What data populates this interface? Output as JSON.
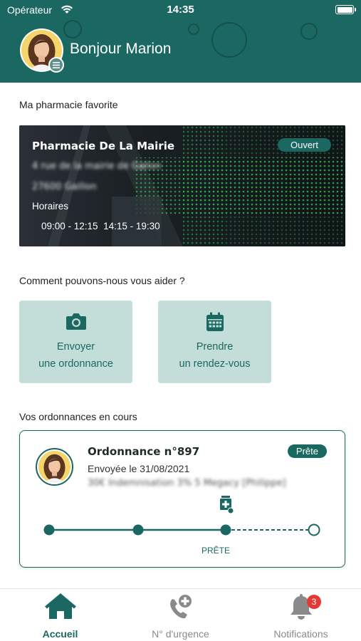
{
  "status_bar": {
    "carrier": "Opérateur",
    "time": "14:35"
  },
  "header": {
    "greeting": "Bonjour Marion",
    "avatar_icon": "user-avatar",
    "menu_icon": "menu-icon",
    "color": "#1b6862"
  },
  "favorite_pharmacy": {
    "section_title": "Ma pharmacie favorite",
    "name": "Pharmacie De La Mairie",
    "address_line1": "4 rue de la mairie de Gallon",
    "address_line2": "27600 Gaillon",
    "hours_label": "Horaires",
    "hours": "09:00 - 12:15  14:15 - 19:30",
    "status_badge": "Ouvert"
  },
  "help": {
    "section_title": "Comment pouvons-nous vous aider ?",
    "actions": [
      {
        "icon": "camera-icon",
        "line1": "Envoyer",
        "line2": "une ordonnance"
      },
      {
        "icon": "calendar-icon",
        "line1": "Prendre",
        "line2": "un rendez-vous"
      }
    ]
  },
  "prescriptions": {
    "section_title": "Vos ordonnances en cours",
    "items": [
      {
        "title": "Ordonnance n°897",
        "sent": "Envoyée le 31/08/2021",
        "detail": "30€  Indemnisation 3% 5 Megacy  [Philippe]",
        "badge": "Prête",
        "status_label": "PRÊTE",
        "progress_steps_total": 4,
        "progress_steps_done": 3
      }
    ]
  },
  "tabbar": {
    "tabs": [
      {
        "label": "Accueil",
        "icon": "home-icon",
        "active": true
      },
      {
        "label": "N° d'urgence",
        "icon": "emergency-phone-icon",
        "active": false
      },
      {
        "label": "Notifications",
        "icon": "bell-icon",
        "active": false,
        "badge": "3"
      }
    ]
  },
  "colors": {
    "primary": "#1b6862",
    "tile_bg": "#c3ddd9",
    "inactive": "#8a8a8a",
    "badge_red": "#e53935"
  }
}
